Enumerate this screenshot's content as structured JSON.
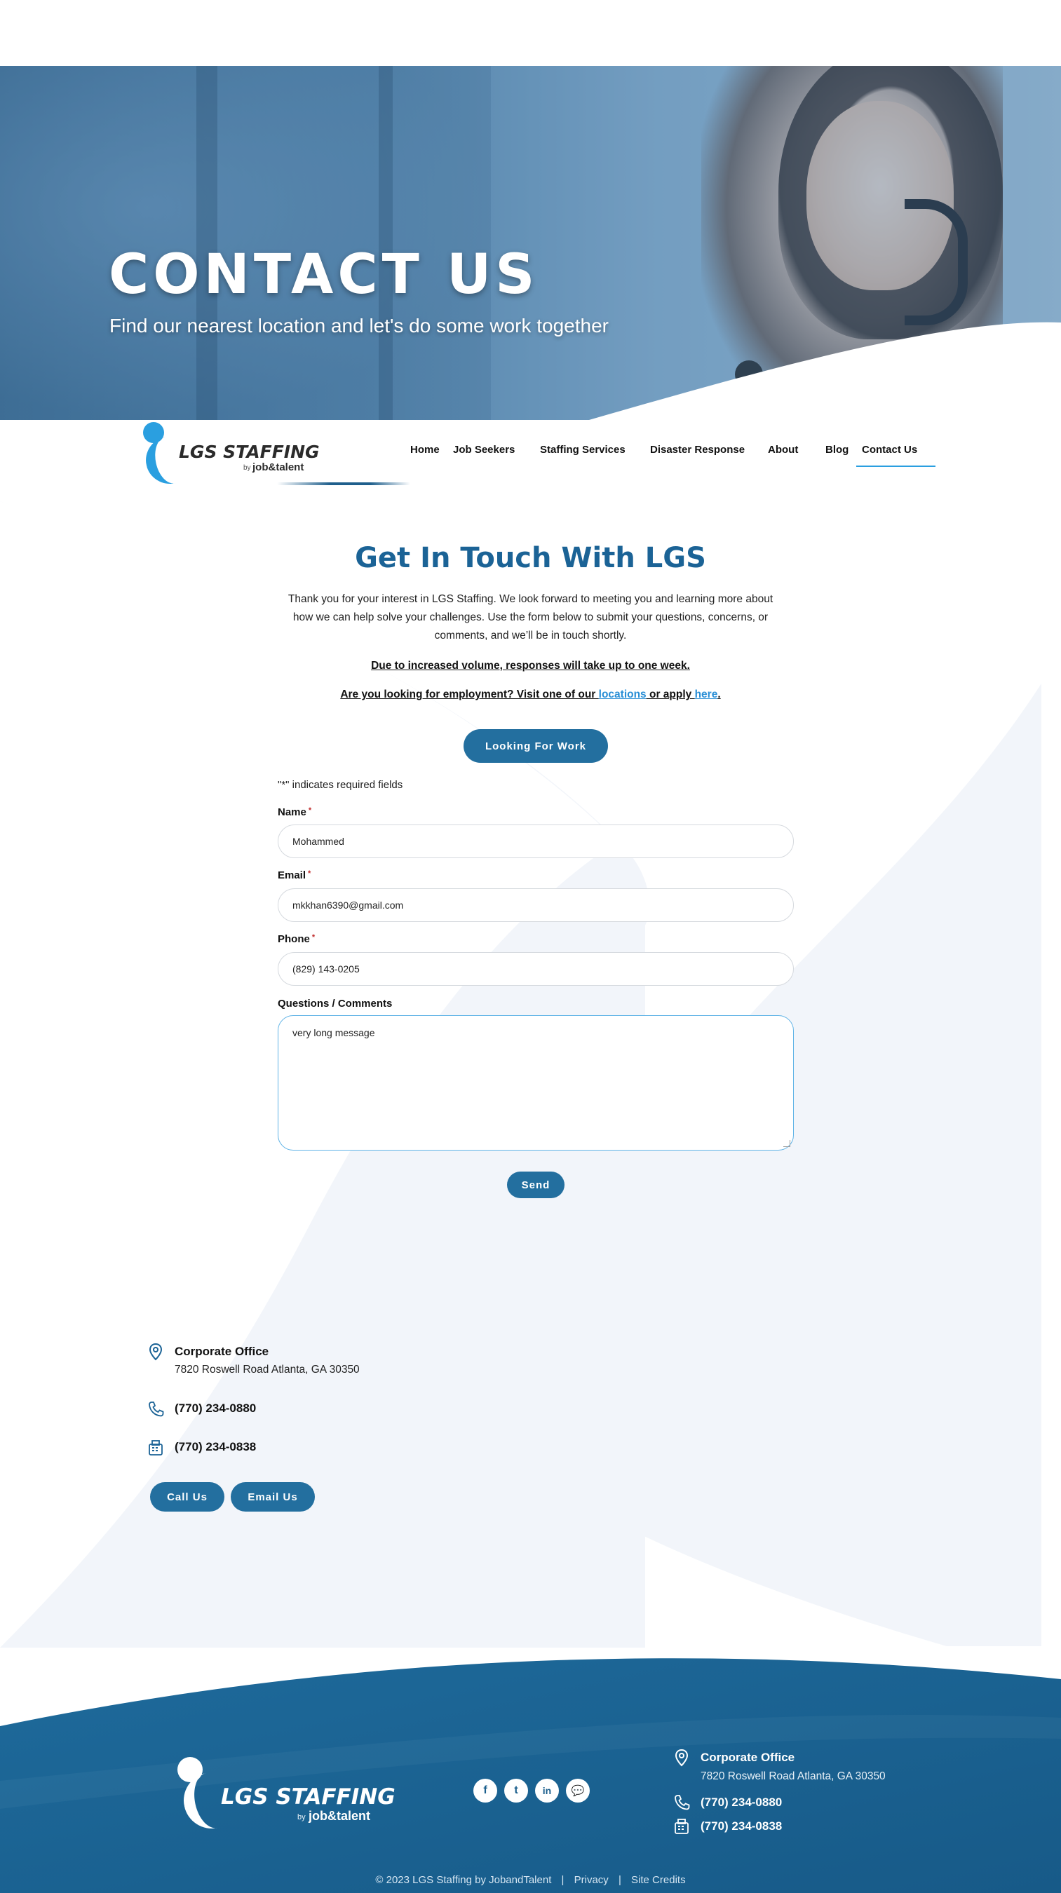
{
  "hero": {
    "title": "CONTACT US",
    "subtitle": "Find our nearest location and let's do some work together"
  },
  "logo": {
    "name": "LGS STAFFING",
    "by": "by",
    "partner": "job&talent"
  },
  "nav": {
    "items": [
      {
        "label": "Home"
      },
      {
        "label": "Job Seekers"
      },
      {
        "label": "Staffing Services"
      },
      {
        "label": "Disaster Response"
      },
      {
        "label": "About"
      },
      {
        "label": "Blog"
      },
      {
        "label": "Contact Us",
        "active": true
      }
    ]
  },
  "main": {
    "heading": "Get In Touch With LGS",
    "intro": "Thank you for your interest in LGS Staffing. We look forward to meeting you and learning more about how we can help solve your challenges. Use the form below to submit your questions, concerns, or comments, and we’ll be in touch shortly.",
    "notice": "Due to increased volume, responses will take up to one week.",
    "employment_prefix": "Are you looking for employment? Visit one of our ",
    "employment_link1": "locations",
    "employment_middle": " or apply ",
    "employment_link2": "here",
    "employment_suffix": ".",
    "looking_button": "Looking For Work"
  },
  "form": {
    "required_note": "\"*\" indicates required fields",
    "required_star": "*",
    "name_label": "Name",
    "name_value": "Mohammed",
    "email_label": "Email",
    "email_value": "mkkhan6390@gmail.com",
    "phone_label": "Phone",
    "phone_value": "(829) 143-0205",
    "comments_label": "Questions / Comments",
    "comments_value": "very long message",
    "send_label": "Send"
  },
  "office": {
    "title": "Corporate Office",
    "address": "7820 Roswell Road Atlanta, GA 30350",
    "phone": "(770) 234-0880",
    "fax": "(770) 234-0838",
    "call_button": "Call Us",
    "email_button": "Email Us",
    "icons": [
      "location-pin-icon",
      "phone-icon",
      "fax-icon"
    ]
  },
  "footer": {
    "logo_name": "LGS STAFFING",
    "logo_by": "by",
    "logo_partner": "job&talent",
    "social": [
      {
        "icon": "facebook-icon",
        "glyph": "f"
      },
      {
        "icon": "twitter-icon",
        "glyph": "t"
      },
      {
        "icon": "linkedin-icon",
        "glyph": "in"
      },
      {
        "icon": "chat-icon",
        "glyph": "💬"
      }
    ],
    "office_title": "Corporate Office",
    "office_address": "7820 Roswell Road Atlanta, GA 30350",
    "office_phone": "(770) 234-0880",
    "office_fax": "(770) 234-0838",
    "copyright": "© 2023 LGS Staffing by JobandTalent",
    "separator": "|",
    "privacy": "Privacy",
    "site_credits": "Site Credits"
  },
  "colors": {
    "brand_blue": "#1b6396",
    "button_blue": "#236f9f",
    "link_blue": "#2a8fd6",
    "footer_blue": "#1f6a9a"
  }
}
